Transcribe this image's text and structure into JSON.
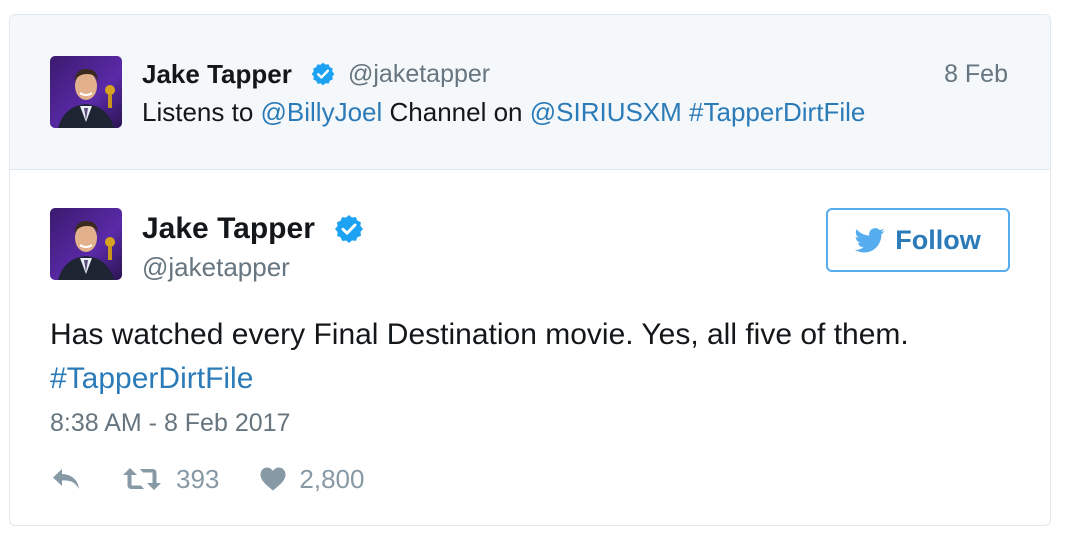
{
  "parent_tweet": {
    "name": "Jake Tapper",
    "handle": "@jaketapper",
    "date": "8 Feb",
    "text_parts": {
      "p0": "Listens to ",
      "p1": "@BillyJoel",
      "p2": " Channel on ",
      "p3": "@SIRIUSXM",
      "p4": " ",
      "p5": "#TapperDirtFile"
    }
  },
  "tweet": {
    "name": "Jake Tapper",
    "handle": "@jaketapper",
    "follow_label": "Follow",
    "text": "Has watched every Final Destination movie. Yes, all five of them.",
    "hashtag": "#TapperDirtFile",
    "timestamp": "8:38 AM - 8 Feb 2017",
    "retweet_count": "393",
    "like_count": "2,800"
  },
  "icons": {
    "verified": "verified-badge-icon",
    "follow": "twitter-bird-icon",
    "reply": "reply-icon",
    "retweet": "retweet-icon",
    "like": "heart-icon"
  },
  "colors": {
    "link": "#2b7bb9",
    "verified": "#1da1f2",
    "follow_border": "#55acee",
    "muted": "#66757f",
    "action_gray": "#8899a6",
    "parent_bg": "#f5f8fa"
  }
}
